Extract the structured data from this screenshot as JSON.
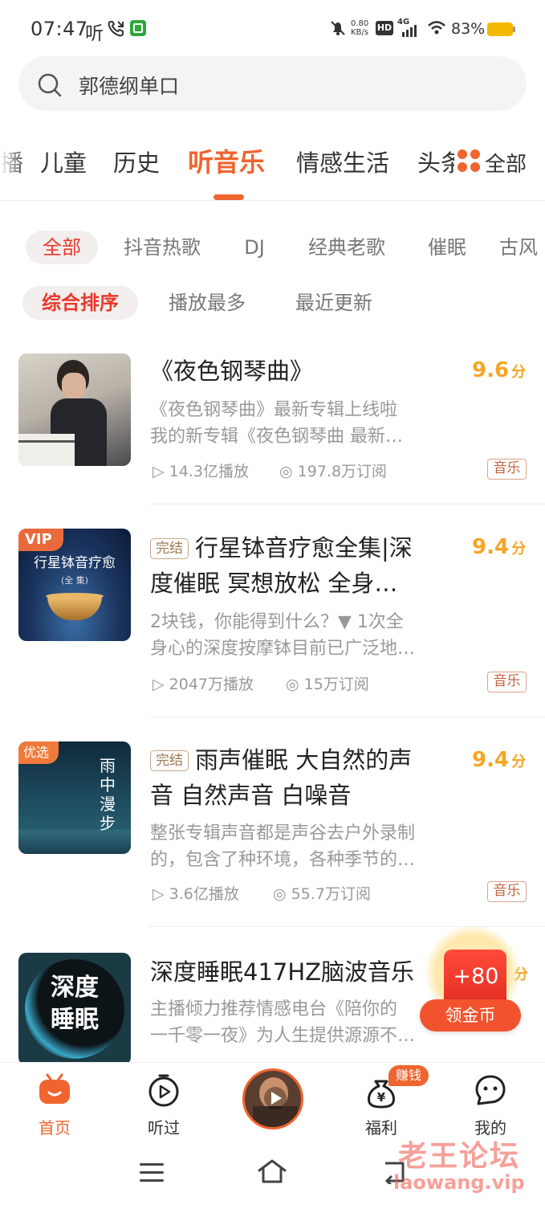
{
  "status_bar": {
    "time": "07:47",
    "carrier_glyph": "听",
    "net_speed_top": "0.80",
    "net_speed_bottom": "KB/s",
    "hd_badge": "HD",
    "signal_label": "4G",
    "battery": "83%",
    "colors": {
      "battery_fill": "#f5b800",
      "app_badge": "#2ea83a"
    }
  },
  "search": {
    "placeholder": "郭德纲单口",
    "icon": "search-icon"
  },
  "channels": {
    "items": [
      "播",
      "儿童",
      "历史",
      "听音乐",
      "情感生活",
      "头条"
    ],
    "active": "听音乐",
    "all_label": "全部",
    "accent": "#f0642f"
  },
  "filters": {
    "categories": [
      "全部",
      "抖音热歌",
      "DJ",
      "经典老歌",
      "催眠",
      "古风"
    ],
    "sorts": [
      "综合排序",
      "播放最多",
      "最近更新"
    ],
    "active_color": "#e8392b"
  },
  "list": [
    {
      "title": "《夜色钢琴曲》",
      "completed": false,
      "score": "9.6",
      "score_unit": "分",
      "desc": [
        "《夜色钢琴曲》最新专辑上线啦",
        "我的新专辑《夜色钢琴曲 最新…"
      ],
      "plays": "14.3亿播放",
      "subs": "197.8万订阅",
      "category": "音乐",
      "badge": ""
    },
    {
      "title_lines": [
        "行星钵音疗愈全集|深",
        "度催眠 冥想放松 全身…"
      ],
      "completed": true,
      "completed_label": "完结",
      "score": "9.4",
      "score_unit": "分",
      "desc": [
        "2块钱，你能得到什么？▼ 1次全",
        "身心的深度按摩钵目前已广泛地…"
      ],
      "plays": "2047万播放",
      "subs": "15万订阅",
      "category": "音乐",
      "badge": "VIP",
      "cover_text": [
        "行星钵音疗愈",
        "(全 集)"
      ]
    },
    {
      "title_lines": [
        "雨声催眠 大自然的声",
        "音 自然声音 白噪音"
      ],
      "completed": true,
      "completed_label": "完结",
      "score": "9.4",
      "score_unit": "分",
      "desc": [
        "整张专辑声音都是声谷去户外录制",
        "的，包含了种环境，各种季节的…"
      ],
      "plays": "3.6亿播放",
      "subs": "55.7万订阅",
      "category": "音乐",
      "badge": "优选",
      "cover_text": [
        "雨",
        "中",
        "漫",
        "步"
      ]
    },
    {
      "title": "深度睡眠417HZ脑波音乐",
      "score_unit": "分",
      "desc": [
        "主播倾力推荐情感电台《陪你的",
        "一千零一夜》为人生提供源源不…"
      ],
      "cover_text": [
        "深度",
        "睡眠"
      ]
    }
  ],
  "floating_reward": {
    "amount": "+80",
    "label": "领金币"
  },
  "bottom_nav": {
    "items": [
      {
        "label": "首页",
        "icon": "home-tv-icon",
        "active": true
      },
      {
        "label": "听过",
        "icon": "play-clock-icon",
        "active": false
      },
      {
        "label": "",
        "icon": "now-playing-disc",
        "active": false
      },
      {
        "label": "福利",
        "icon": "money-bag-icon",
        "active": false,
        "badge": "赚钱"
      },
      {
        "label": "我的",
        "icon": "face-bubble-icon",
        "active": false
      }
    ],
    "active_color": "#f0642f"
  },
  "watermark": {
    "line1": "老王论坛",
    "line2": "laowang.vip"
  }
}
